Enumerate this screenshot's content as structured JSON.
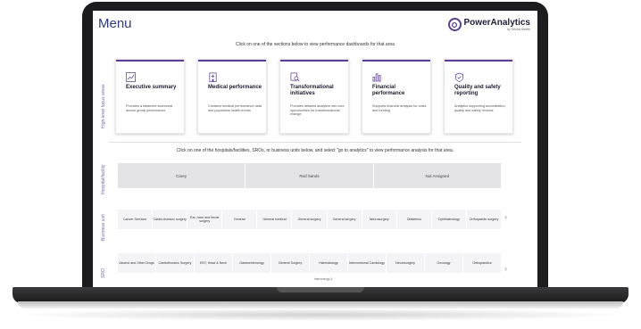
{
  "header": {
    "title": "Menu",
    "brand_name": "PowerAnalytics",
    "brand_sub": "by Telstra Health"
  },
  "instructions": {
    "top": "Click on one of the sections below to view performance dashboards for that area",
    "middle": "Click on one of the hospitals/facilities, SROs, or business units below, and select \"go to analytics\" to view performance analysis for that area."
  },
  "side_labels": {
    "focus": "High-level focus areas",
    "hospital": "Hospital/facility",
    "business_unit": "Business unit",
    "sro": "SRO"
  },
  "cards": [
    {
      "title": "Executive summary",
      "desc": "Provides a balanced scorecard across group performance",
      "icon": "chart-trend-icon"
    },
    {
      "title": "Medical performance",
      "desc": "Contains medical performance data and population health trends",
      "icon": "hospital-icon"
    },
    {
      "title": "Transformational initiatives",
      "desc": "Provides detailed analytics into core opportunities for transformational change",
      "icon": "search-doc-icon"
    },
    {
      "title": "Financial performance",
      "desc": "Supports financial analysis for costs and funding",
      "icon": "bar-chart-icon"
    },
    {
      "title": "Quality and safety reporting",
      "desc": "Analytics supporting accreditation, quality and safety reviews",
      "icon": "shield-check-icon"
    }
  ],
  "hospitals": [
    "Carey",
    "Red Sands",
    "Not Assigned"
  ],
  "business_units": [
    "Cancer Services",
    "Cardio-thoracic surgery",
    "Ear, nose and throat surgery",
    "General",
    "General medical",
    "General surgery",
    "General surgery",
    "Neurosurgery",
    "Obstetrics",
    "Ophthalmology",
    "Orthopaedic surgery"
  ],
  "sros": [
    "Alcohol and Other Drugs",
    "Cardiothoracic Surgery",
    "ENT, Head & Neck",
    "Gastroenterology",
    "General Surgery",
    "Haematology",
    "Interventional Cardiology",
    "Neurosurgery",
    "Oncology",
    "Orthopaedics"
  ],
  "sro_peek": "Immunology &",
  "colors": {
    "accent": "#5b3e96",
    "title": "#2b3a8c"
  }
}
